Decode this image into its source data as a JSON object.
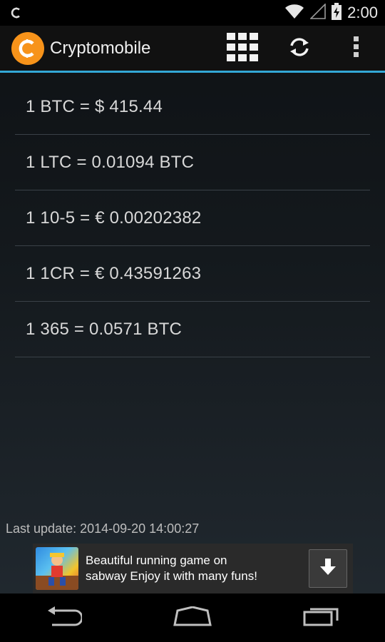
{
  "status_bar": {
    "time": "2:00",
    "icons": [
      "notification-c-icon",
      "wifi-icon",
      "cell-signal-icon",
      "battery-charging-icon"
    ]
  },
  "action_bar": {
    "title": "Cryptomobile",
    "accent_color": "#33a8d6",
    "logo_color": "#f7931a",
    "actions": [
      "grid-icon",
      "refresh-icon",
      "overflow-menu-icon"
    ]
  },
  "rates": [
    {
      "label": "1 BTC = $ 415.44"
    },
    {
      "label": "1 LTC = 0.01094 BTC"
    },
    {
      "label": "1 10-5 = € 0.00202382"
    },
    {
      "label": "1 1CR = € 0.43591263"
    },
    {
      "label": "1 365 = 0.0571 BTC"
    }
  ],
  "last_update": "Last update: 2014-09-20 14:00:27",
  "ad": {
    "line1": "Beautiful running game on",
    "line2": "sabway Enjoy it with many funs!"
  },
  "nav_bar": {
    "buttons": [
      "back-icon",
      "home-icon",
      "recent-apps-icon"
    ]
  }
}
